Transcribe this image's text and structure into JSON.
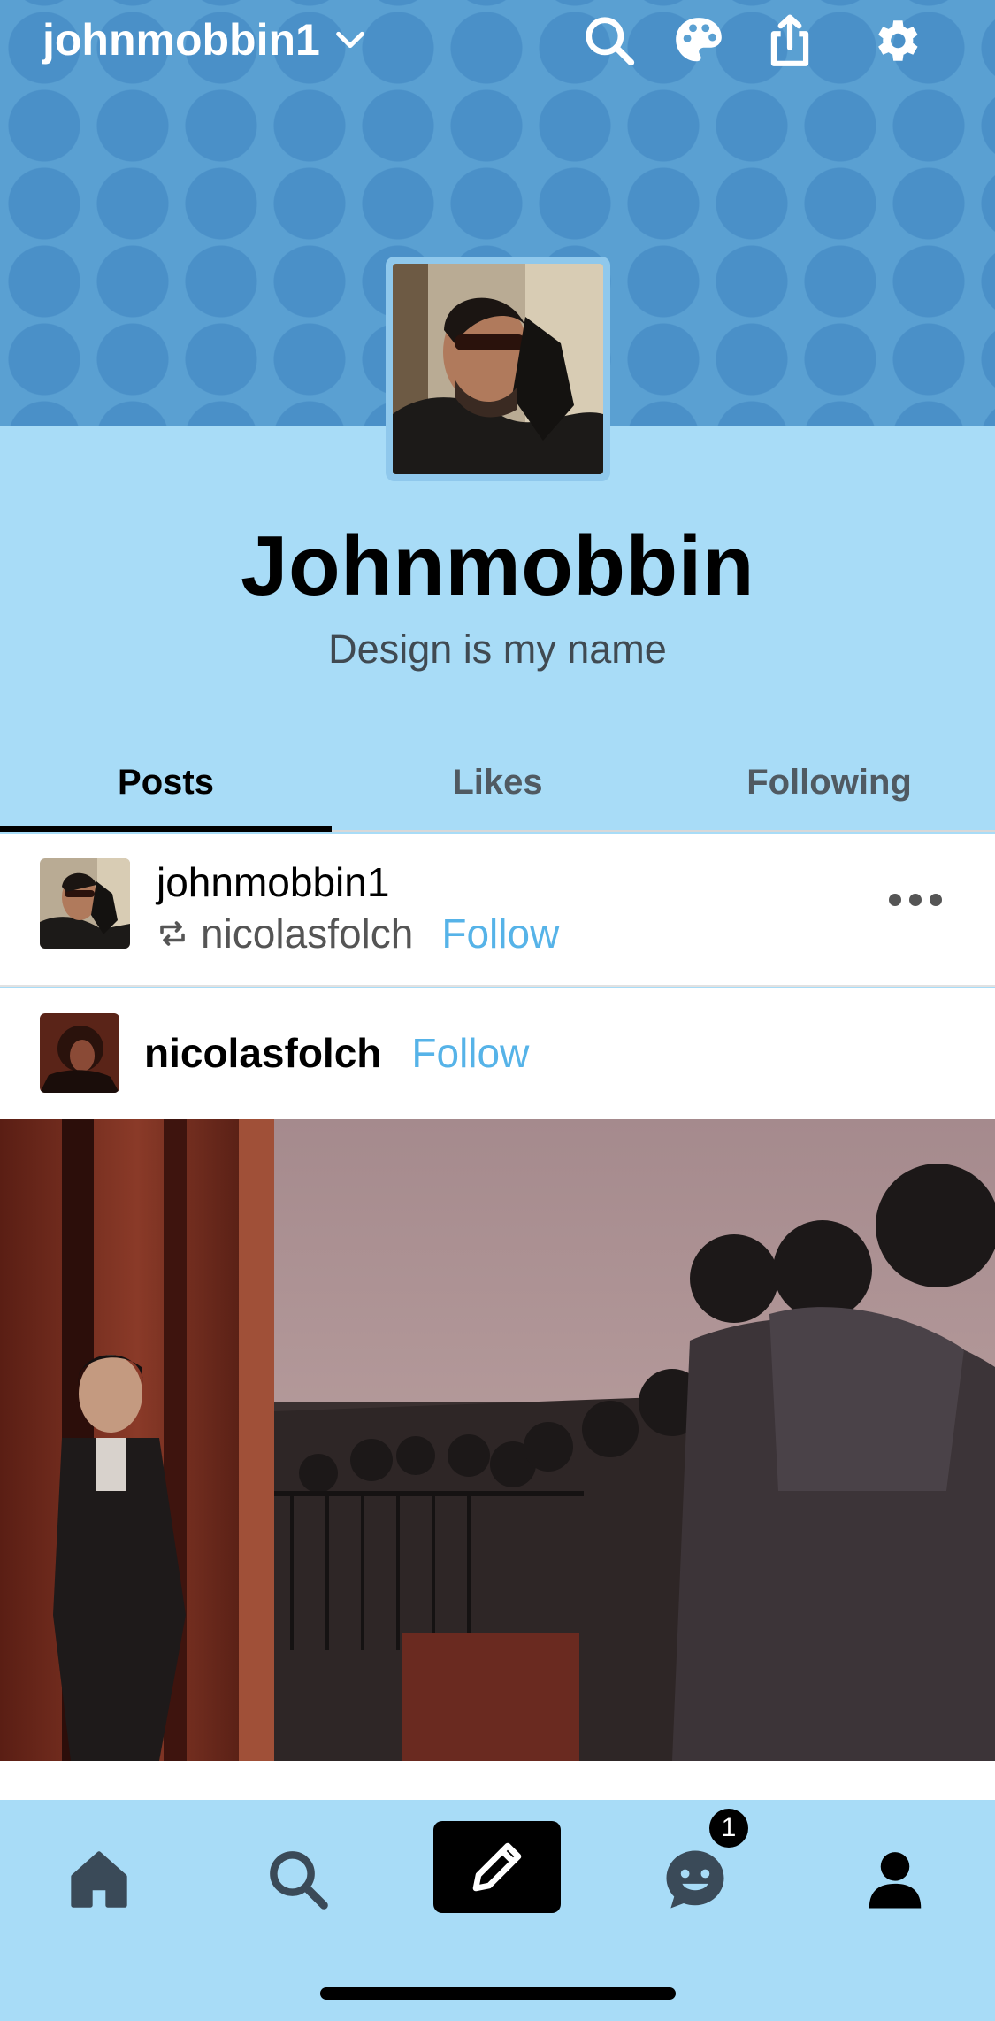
{
  "topbar": {
    "blog_name": "johnmobbin1",
    "icons": [
      "chevron-down-icon",
      "search-icon",
      "palette-icon",
      "share-icon",
      "gear-icon"
    ]
  },
  "profile": {
    "title": "Johnmobbin",
    "description": "Design is my name"
  },
  "tabs": [
    {
      "label": "Posts",
      "active": true
    },
    {
      "label": "Likes",
      "active": false
    },
    {
      "label": "Following",
      "active": false
    }
  ],
  "post": {
    "author": "johnmobbin1",
    "reblogged_from": "nicolasfolch",
    "follow_label": "Follow",
    "source_author": "nicolasfolch",
    "source_follow_label": "Follow"
  },
  "bottom_nav": {
    "items": [
      "home-icon",
      "search-icon",
      "compose-icon",
      "activity-icon",
      "account-icon"
    ],
    "badge_count": "1"
  },
  "colors": {
    "accent": "#56b3e8",
    "background": "#a8dcf7",
    "header": "#5aa0d2"
  }
}
